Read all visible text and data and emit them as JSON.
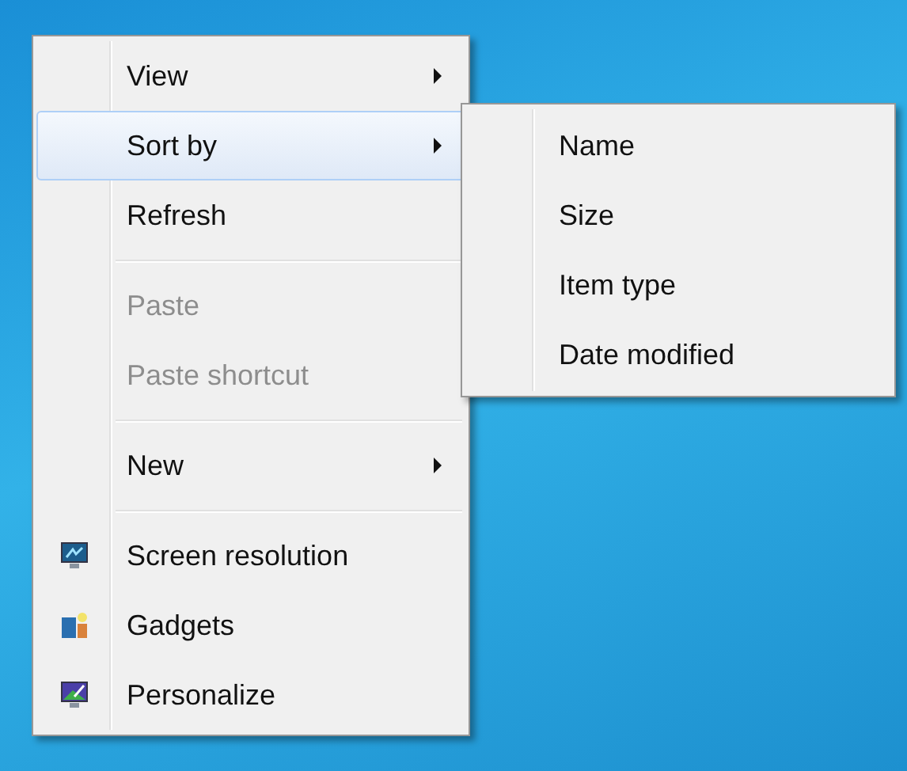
{
  "context_menu": {
    "items": [
      {
        "kind": "item",
        "label": "View",
        "submenu": true,
        "disabled": false,
        "selected": false
      },
      {
        "kind": "item",
        "label": "Sort by",
        "submenu": true,
        "disabled": false,
        "selected": true
      },
      {
        "kind": "item",
        "label": "Refresh",
        "submenu": false,
        "disabled": false,
        "selected": false
      },
      {
        "kind": "separator"
      },
      {
        "kind": "item",
        "label": "Paste",
        "submenu": false,
        "disabled": true,
        "selected": false
      },
      {
        "kind": "item",
        "label": "Paste shortcut",
        "submenu": false,
        "disabled": true,
        "selected": false
      },
      {
        "kind": "separator"
      },
      {
        "kind": "item",
        "label": "New",
        "submenu": true,
        "disabled": false,
        "selected": false
      },
      {
        "kind": "separator"
      },
      {
        "kind": "icon_item",
        "label": "Screen resolution",
        "submenu": false,
        "disabled": false,
        "selected": false
      },
      {
        "kind": "icon_item",
        "label": "Gadgets",
        "submenu": false,
        "disabled": false,
        "selected": false
      },
      {
        "kind": "icon_item",
        "label": "Personalize",
        "submenu": false,
        "disabled": false,
        "selected": false
      }
    ]
  },
  "submenu": {
    "items": [
      {
        "label": "Name",
        "selected": false
      },
      {
        "label": "Size",
        "selected": false
      },
      {
        "label": "Item type",
        "selected": false
      },
      {
        "label": "Date modified",
        "selected": false
      }
    ]
  }
}
